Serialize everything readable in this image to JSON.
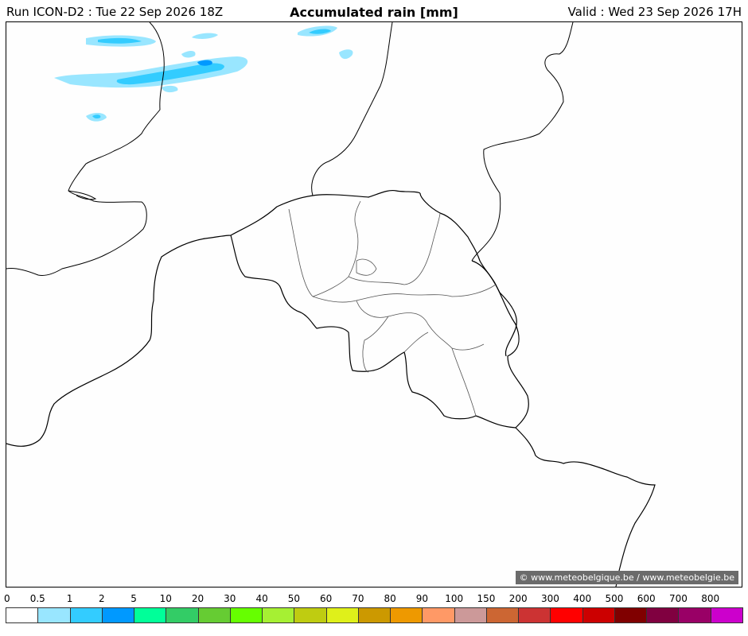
{
  "header": {
    "run": "Run ICON-D2 : Tue 22 Sep 2026 18Z",
    "title": "Accumulated rain [mm]",
    "valid": "Valid : Wed 23 Sep 2026 17H"
  },
  "credit": "© www.meteobelgique.be / www.meteobelgie.be",
  "legend": {
    "labels": [
      "0",
      "0.5",
      "1",
      "2",
      "5",
      "10",
      "20",
      "30",
      "40",
      "50",
      "60",
      "70",
      "80",
      "90",
      "100",
      "150",
      "200",
      "300",
      "400",
      "500",
      "600",
      "700",
      "800"
    ],
    "colors": [
      "#ffffff",
      "#99e6ff",
      "#33ccff",
      "#0099ff",
      "#00ff99",
      "#33cc66",
      "#66cc33",
      "#66ff00",
      "#a6f033",
      "#bfcc11",
      "#dff01a",
      "#cc9900",
      "#ee9900",
      "#ff9966",
      "#cc9999",
      "#cc6633",
      "#cc3333",
      "#ff0000",
      "#cc0000",
      "#800000",
      "#800040",
      "#990066",
      "#cc00cc"
    ]
  },
  "colors": {
    "rain_light": "#99e6ff",
    "rain_medium": "#33ccff",
    "rain_heavy": "#0099ff",
    "coast": "#000000",
    "province": "#555555"
  }
}
